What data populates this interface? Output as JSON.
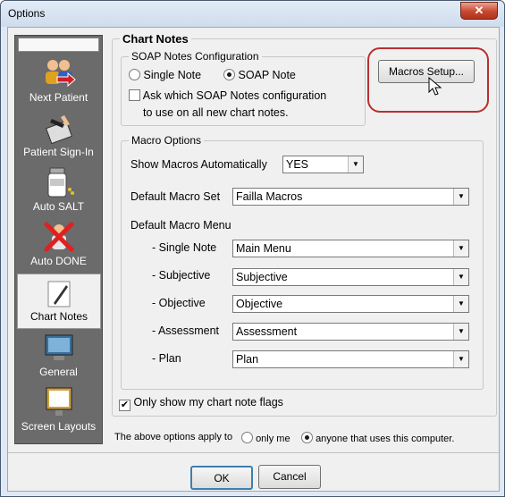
{
  "window": {
    "title": "Options",
    "close_glyph": "✕"
  },
  "sidebar": {
    "items": [
      {
        "label": "Next Patient",
        "icon": "next-patient-icon"
      },
      {
        "label": "Patient Sign-In",
        "icon": "patient-sign-in-icon"
      },
      {
        "label": "Auto SALT",
        "icon": "auto-salt-icon"
      },
      {
        "label": "Auto DONE",
        "icon": "auto-done-icon"
      },
      {
        "label": "Chart Notes",
        "icon": "chart-notes-icon",
        "active": true
      },
      {
        "label": "General",
        "icon": "general-monitor-icon"
      },
      {
        "label": "Screen Layouts",
        "icon": "screen-layouts-icon"
      }
    ]
  },
  "chart_notes": {
    "title": "Chart Notes",
    "soap_config": {
      "title": "SOAP Notes Configuration",
      "option_single": "Single Note",
      "option_soap": "SOAP Note",
      "selected": "SOAP Note",
      "ask_line1": "Ask which SOAP Notes configuration",
      "ask_line2": "to use on all new chart notes.",
      "ask_checked": false
    },
    "macros_setup_label": "Macros Setup...",
    "macro_options": {
      "title": "Macro Options",
      "show_macros_label": "Show Macros Automatically",
      "show_macros_value": "YES",
      "default_set_label": "Default Macro Set",
      "default_set_value": "Failla Macros",
      "default_menu_label": "Default Macro Menu",
      "menus": [
        {
          "label": "- Single Note",
          "value": "Main Menu"
        },
        {
          "label": "- Subjective",
          "value": "Subjective"
        },
        {
          "label": "- Objective",
          "value": "Objective"
        },
        {
          "label": "- Assessment",
          "value": "Assessment"
        },
        {
          "label": "- Plan",
          "value": "Plan"
        }
      ]
    },
    "only_show_flags_label": "Only show my chart note flags",
    "only_show_flags_checked": true
  },
  "apply_to": {
    "label": "The above options apply to",
    "option_me": "only me",
    "option_anyone": "anyone that uses this computer.",
    "selected": "anyone that uses this computer."
  },
  "buttons": {
    "ok": "OK",
    "cancel": "Cancel"
  },
  "check_glyph": "✔",
  "arrow_glyph": "▼",
  "colors": {
    "highlight": "#b83030",
    "sidebar_bg": "#6b6b6b"
  }
}
